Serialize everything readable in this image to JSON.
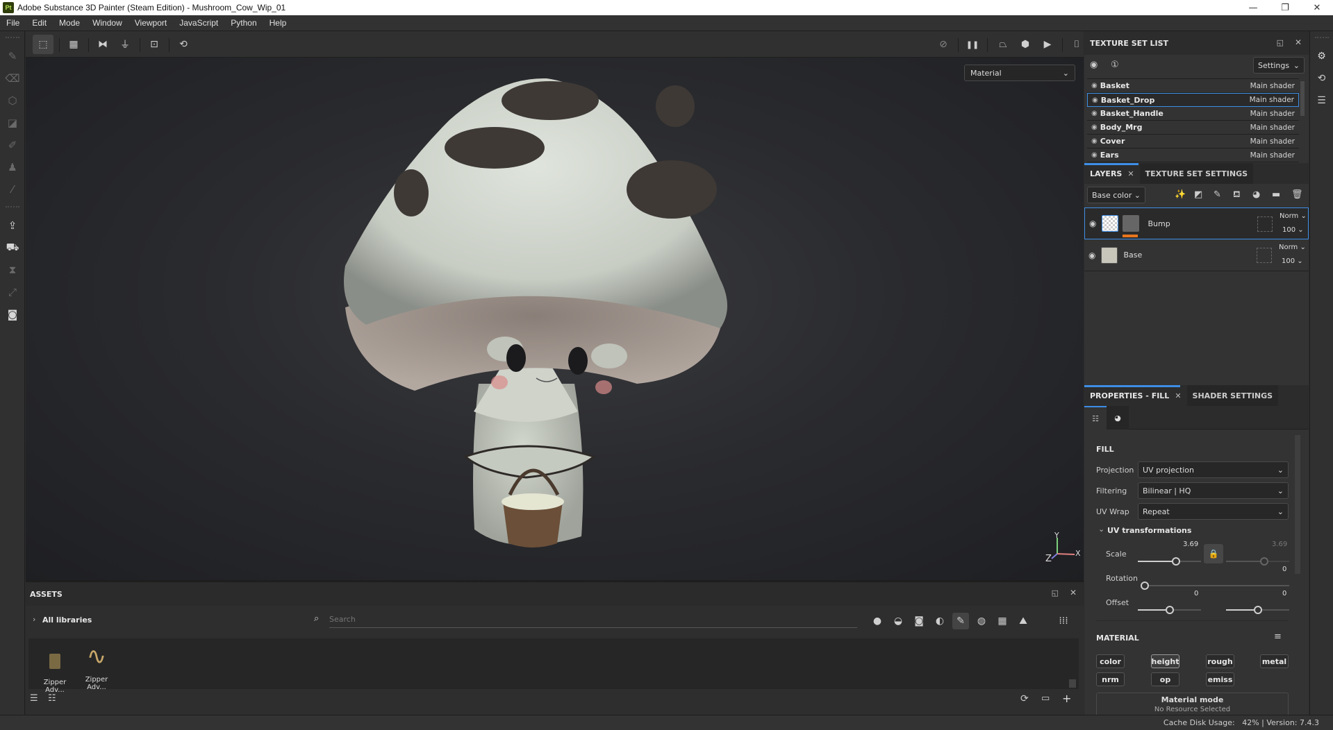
{
  "window": {
    "app_icon": "Pt",
    "title": "Adobe Substance 3D Painter (Steam Edition) - Mushroom_Cow_Wip_01",
    "controls": {
      "minimize": "—",
      "maximize": "❐",
      "close": "✕"
    }
  },
  "menu": [
    "File",
    "Edit",
    "Mode",
    "Window",
    "Viewport",
    "JavaScript",
    "Python",
    "Help"
  ],
  "left_tools": [
    {
      "name": "paint-brush-icon",
      "glyph": "✎"
    },
    {
      "name": "eraser-icon",
      "glyph": "⌫"
    },
    {
      "name": "projection-icon",
      "glyph": "⬡"
    },
    {
      "name": "polygon-fill-icon",
      "glyph": "◪"
    },
    {
      "name": "smudge-icon",
      "glyph": "✐"
    },
    {
      "name": "clone-stamp-icon",
      "glyph": "♟"
    },
    {
      "name": "color-picker-icon",
      "glyph": "⁄"
    },
    {
      "name": "export-icon",
      "glyph": "⇪"
    },
    {
      "name": "bake-icon",
      "glyph": "⛟"
    },
    {
      "name": "timer-icon",
      "glyph": "⧗"
    },
    {
      "name": "resize-icon",
      "glyph": "⤢"
    },
    {
      "name": "plugin-icon",
      "glyph": "◙"
    }
  ],
  "toolbar": {
    "left": [
      {
        "name": "selection-mode-icon",
        "glyph": "⬚"
      },
      {
        "name": "grid-layout-icon",
        "glyph": "▦"
      },
      {
        "name": "symmetry-x-icon",
        "glyph": "⧓"
      },
      {
        "name": "symmetry-y-icon",
        "glyph": "⏚"
      },
      {
        "name": "frame-focus-icon",
        "glyph": "⊡"
      },
      {
        "name": "reset-view-icon",
        "glyph": "⟲"
      }
    ],
    "right": [
      {
        "name": "hide-ui-icon",
        "glyph": "⊘"
      },
      {
        "name": "pause-icon",
        "glyph": "❚❚"
      },
      {
        "name": "camera-perspective-icon",
        "glyph": "⏢"
      },
      {
        "name": "display-mode-icon",
        "glyph": "⬢"
      },
      {
        "name": "video-camera-icon",
        "glyph": "▶"
      },
      {
        "name": "screenshot-icon",
        "glyph": "⌷"
      }
    ]
  },
  "viewport": {
    "mode_select": "Material",
    "axis": {
      "x": "X",
      "y": "Y",
      "z": "Z"
    }
  },
  "texture_set_list": {
    "title": "TEXTURE SET LIST",
    "settings_label": "Settings",
    "items": [
      {
        "name": "Basket",
        "shader": "Main shader",
        "selected": false
      },
      {
        "name": "Basket_Drop",
        "shader": "Main shader",
        "selected": true
      },
      {
        "name": "Basket_Handle",
        "shader": "Main shader",
        "selected": false
      },
      {
        "name": "Body_Mrg",
        "shader": "Main shader",
        "selected": false
      },
      {
        "name": "Cover",
        "shader": "Main shader",
        "selected": false
      },
      {
        "name": "Ears",
        "shader": "Main shader",
        "selected": false
      }
    ]
  },
  "layers_panel": {
    "tabs": [
      "LAYERS",
      "TEXTURE SET SETTINGS"
    ],
    "channel_select": "Base color",
    "layers": [
      {
        "name": "Bump",
        "blend": "Norm",
        "opacity": "100",
        "selected": true
      },
      {
        "name": "Base",
        "blend": "Norm",
        "opacity": "100",
        "selected": false
      }
    ]
  },
  "properties": {
    "tabs": [
      "PROPERTIES - FILL",
      "SHADER SETTINGS"
    ],
    "section_fill": "FILL",
    "projection_label": "Projection",
    "projection_value": "UV projection",
    "filtering_label": "Filtering",
    "filtering_value": "Bilinear | HQ",
    "uvwrap_label": "UV Wrap",
    "uvwrap_value": "Repeat",
    "uv_transform_title": "UV transformations",
    "scale_label": "Scale",
    "scale_u": "3.69",
    "scale_v": "3.69",
    "rotation_label": "Rotation",
    "rotation_value": "0",
    "offset_label": "Offset",
    "offset_u": "0",
    "offset_v": "0",
    "section_material": "MATERIAL",
    "material_channels": [
      {
        "label": "color",
        "on": false
      },
      {
        "label": "height",
        "on": true
      },
      {
        "label": "rough",
        "on": false
      },
      {
        "label": "metal",
        "on": false
      },
      {
        "label": "nrm",
        "on": false
      },
      {
        "label": "op",
        "on": false
      },
      {
        "label": "emiss",
        "on": false
      }
    ],
    "material_mode_label": "Material mode",
    "material_mode_sub": "No Resource Selected"
  },
  "assets": {
    "title": "ASSETS",
    "library": "All libraries",
    "search_placeholder": "Search",
    "items": [
      {
        "label": "Zipper Adv..."
      },
      {
        "label": "Zipper Adv..."
      }
    ]
  },
  "status": {
    "text": "Cache Disk Usage:   42% | Version: 7.4.3"
  },
  "colors": {
    "accent": "#3d8ee6",
    "layer_mask_bar": "#e8761e"
  }
}
